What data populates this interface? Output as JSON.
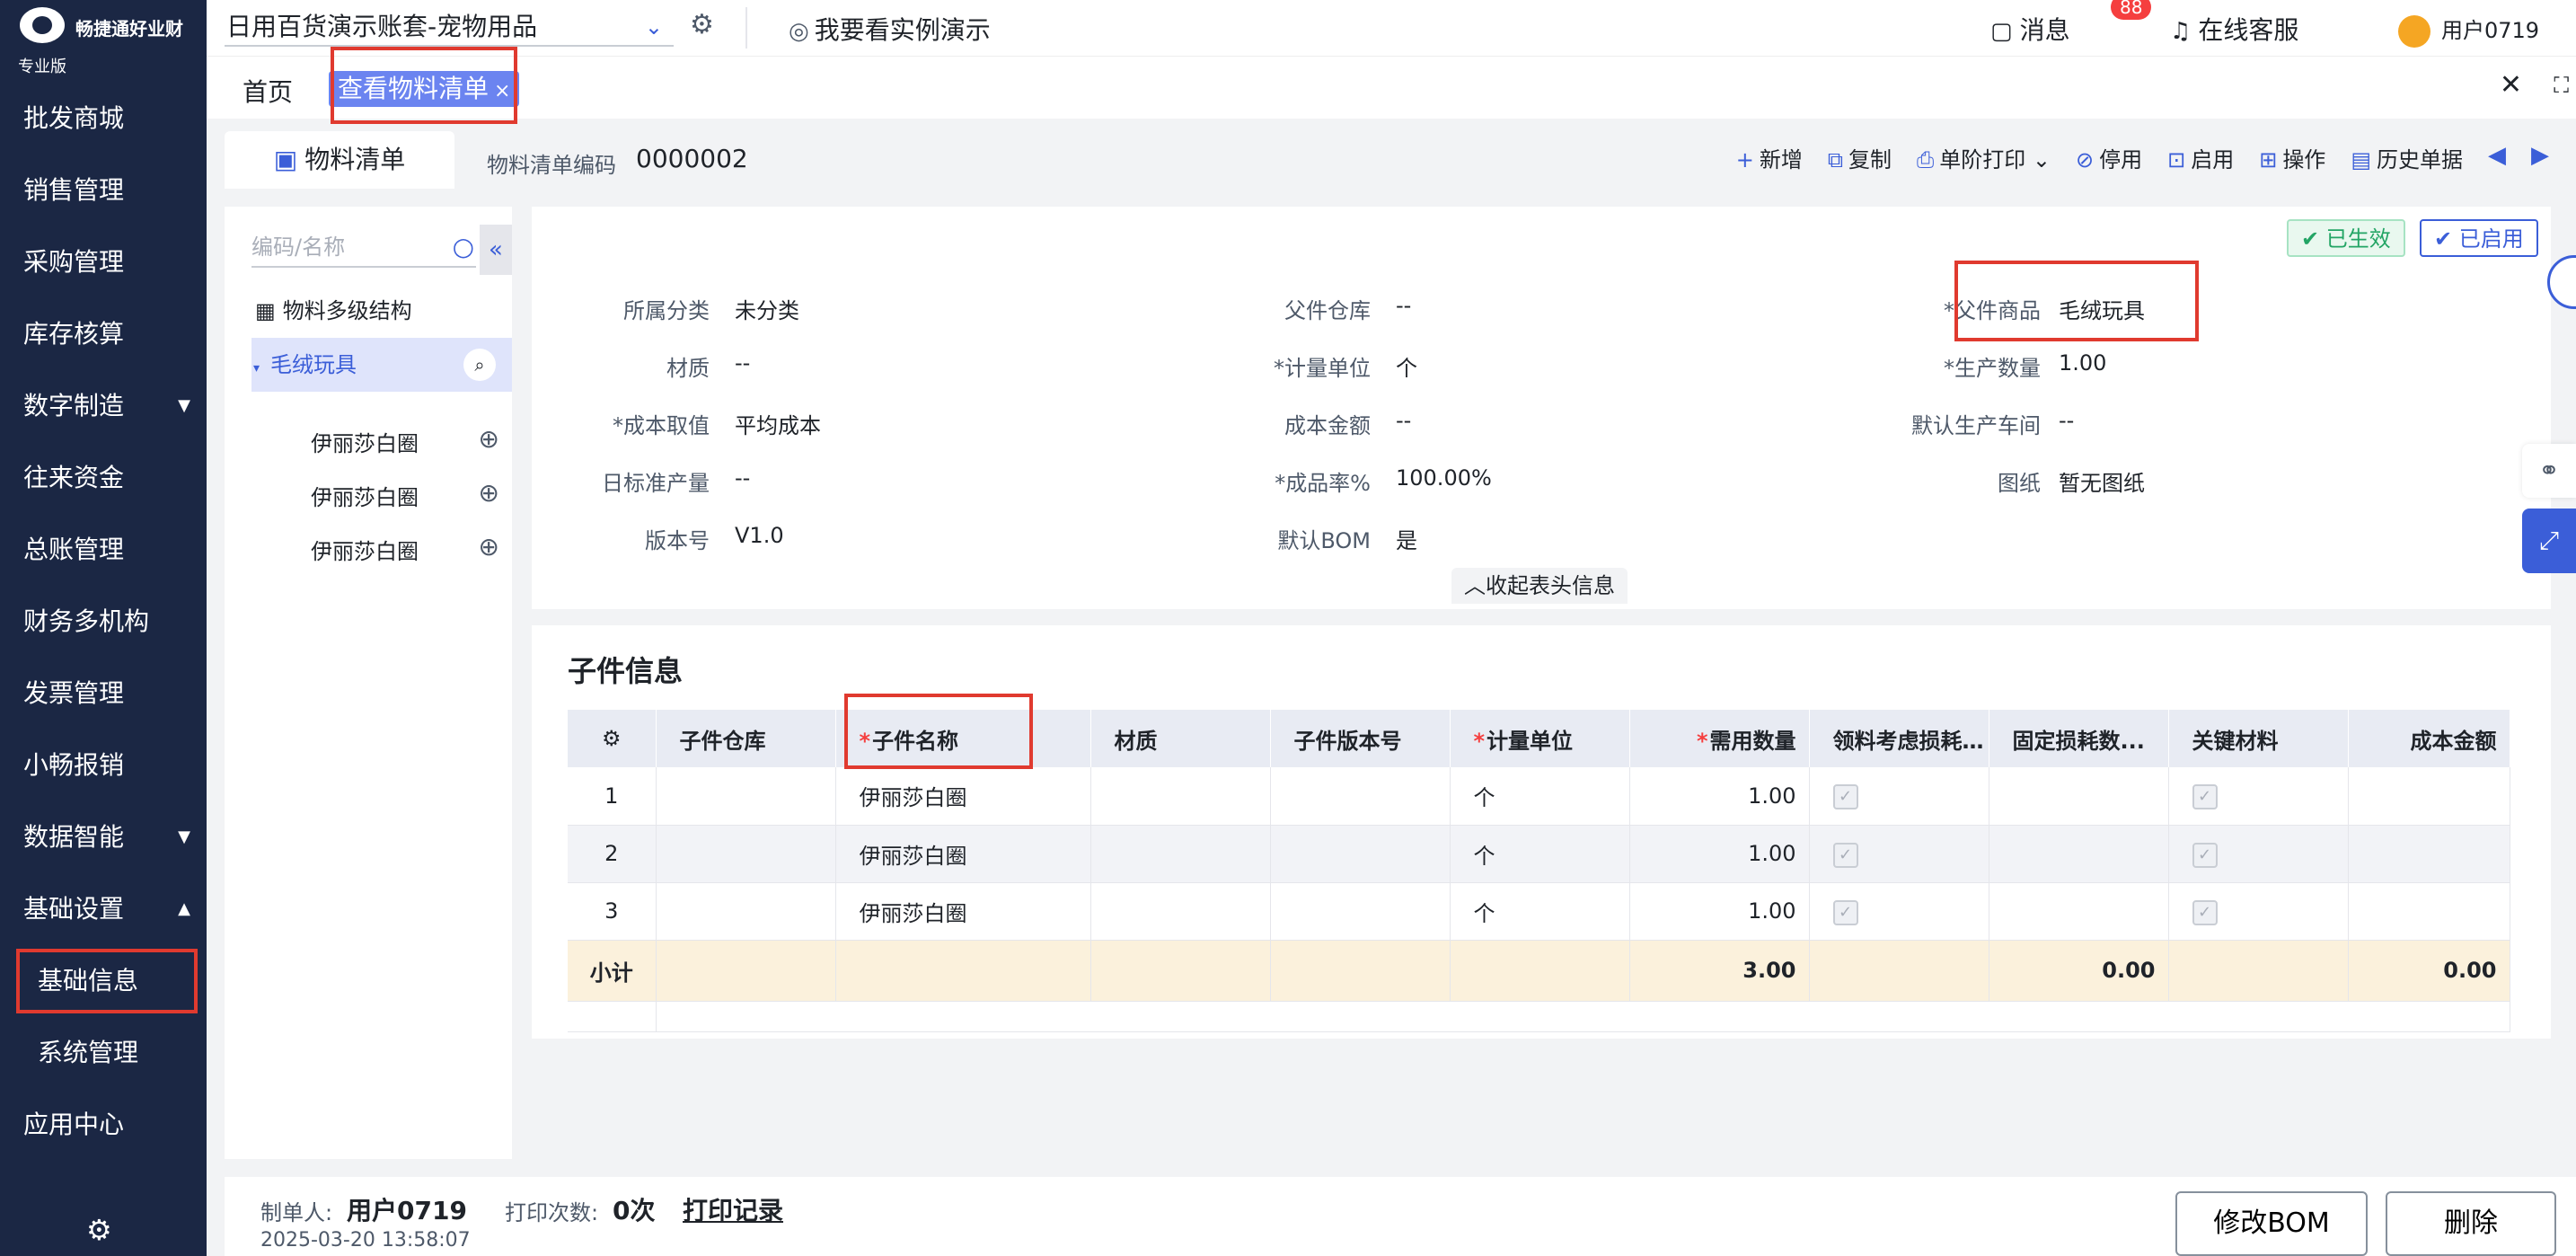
{
  "brand": {
    "name": "畅捷通好业财",
    "edition": "专业版"
  },
  "sidebar": {
    "items": [
      {
        "label": "批发商城",
        "caret": ""
      },
      {
        "label": "销售管理",
        "caret": ""
      },
      {
        "label": "采购管理",
        "caret": ""
      },
      {
        "label": "库存核算",
        "caret": ""
      },
      {
        "label": "数字制造",
        "caret": "▼"
      },
      {
        "label": "往来资金",
        "caret": ""
      },
      {
        "label": "总账管理",
        "caret": ""
      },
      {
        "label": "财务多机构",
        "caret": ""
      },
      {
        "label": "发票管理",
        "caret": ""
      },
      {
        "label": "小畅报销",
        "caret": ""
      },
      {
        "label": "数据智能",
        "caret": "▼"
      },
      {
        "label": "基础设置",
        "caret": "▲"
      },
      {
        "label": "基础信息",
        "caret": ""
      },
      {
        "label": "系统管理",
        "caret": ""
      },
      {
        "label": "应用中心",
        "caret": ""
      }
    ]
  },
  "topbar": {
    "account": "日用百货演示账套-宠物用品",
    "demo_link": "我要看实例演示",
    "messages_label": "消息",
    "messages_count": "88",
    "service_label": "在线客服",
    "user_name": "用户0719"
  },
  "tabs": {
    "home": "首页",
    "active": "查看物料清单"
  },
  "subheader": {
    "doc_tab": "物料清单",
    "bom_code_label": "物料清单编码",
    "bom_code_value": "0000002",
    "toolbar": {
      "add": "新增",
      "copy": "复制",
      "print": "单阶打印",
      "disable": "停用",
      "enable": "启用",
      "operate": "操作",
      "history": "历史单据"
    }
  },
  "tree": {
    "search_placeholder": "编码/名称",
    "root": "物料多级结构",
    "node": "毛绒玩具",
    "children": [
      "伊丽莎白圈",
      "伊丽莎白圈",
      "伊丽莎白圈"
    ]
  },
  "header": {
    "status_effective": "已生效",
    "status_enabled": "已启用",
    "collapse_label": "收起表头信息",
    "fields": {
      "category": {
        "label": "所属分类",
        "value": "未分类"
      },
      "material": {
        "label": "材质",
        "value": "--"
      },
      "cost_method": {
        "label": "成本取值",
        "value": "平均成本"
      },
      "daily_output": {
        "label": "日标准产量",
        "value": "--"
      },
      "version": {
        "label": "版本号",
        "value": "V1.0"
      },
      "parent_warehouse": {
        "label": "父件仓库",
        "value": "--"
      },
      "unit": {
        "label": "计量单位",
        "value": "个"
      },
      "cost_amount": {
        "label": "成本金额",
        "value": "--"
      },
      "yield_rate": {
        "label": "成品率%",
        "value": "100.00%"
      },
      "default_bom": {
        "label": "默认BOM",
        "value": "是"
      },
      "parent_product": {
        "label": "父件商品",
        "value": "毛绒玩具"
      },
      "production_qty": {
        "label": "生产数量",
        "value": "1.00"
      },
      "default_workshop": {
        "label": "默认生产车间",
        "value": "--"
      },
      "drawing": {
        "label": "图纸",
        "value": "暂无图纸"
      }
    }
  },
  "child_info": {
    "title": "子件信息",
    "columns": [
      "子件仓库",
      "子件名称",
      "材质",
      "子件版本号",
      "计量单位",
      "需用数量",
      "领料考虑损耗 ...",
      "固定损耗数...",
      "关键材料",
      "成本金额"
    ],
    "rows": [
      {
        "idx": "1",
        "warehouse": "",
        "name": "伊丽莎白圈",
        "material": "",
        "version": "",
        "unit": "个",
        "qty": "1.00",
        "fixed_loss": "",
        "cost": ""
      },
      {
        "idx": "2",
        "warehouse": "",
        "name": "伊丽莎白圈",
        "material": "",
        "version": "",
        "unit": "个",
        "qty": "1.00",
        "fixed_loss": "",
        "cost": ""
      },
      {
        "idx": "3",
        "warehouse": "",
        "name": "伊丽莎白圈",
        "material": "",
        "version": "",
        "unit": "个",
        "qty": "1.00",
        "fixed_loss": "",
        "cost": ""
      }
    ],
    "subtotal": {
      "label": "小计",
      "qty": "3.00",
      "fixed_loss": "0.00",
      "cost": "0.00"
    }
  },
  "footer": {
    "creator_label": "制单人:",
    "creator": "用户0719",
    "created_at": "2025-03-20 13:58:07",
    "print_label": "打印次数:",
    "print_count": "0次",
    "print_record": "打印记录",
    "modify_button": "修改BOM",
    "delete_button": "删除"
  }
}
